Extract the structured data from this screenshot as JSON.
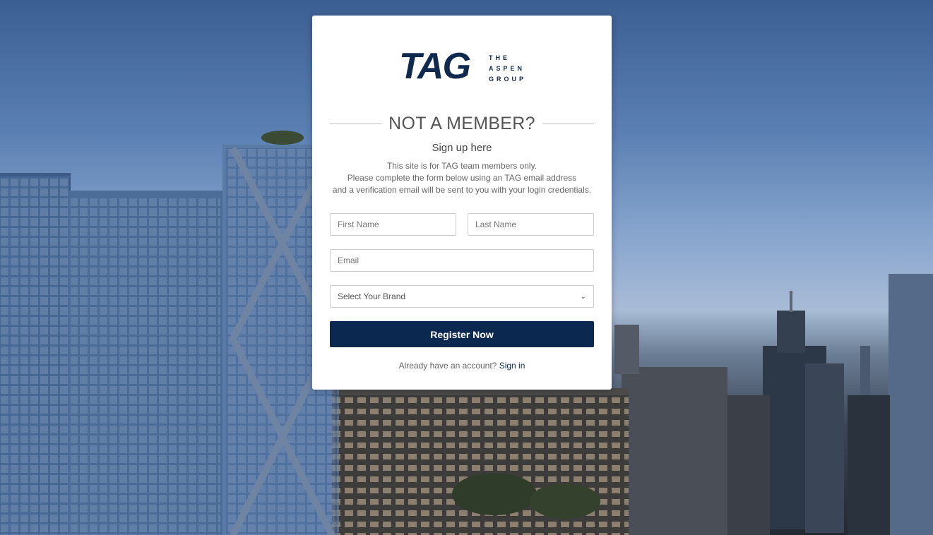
{
  "logo": {
    "wordmark": "TAG",
    "tagline": [
      "THE",
      "ASPEN",
      "GROUP"
    ]
  },
  "heading": "NOT A MEMBER?",
  "subheading": "Sign up here",
  "description": [
    "This site is for TAG team members only.",
    "Please complete the form below using an TAG email address",
    "and a verification email will be sent to you with your login credentials."
  ],
  "form": {
    "first_name_placeholder": "First Name",
    "last_name_placeholder": "Last Name",
    "email_placeholder": "Email",
    "brand_select": "Select Your Brand",
    "submit_label": "Register Now"
  },
  "footer": {
    "prompt": "Already have an account?",
    "link": "Sign in"
  },
  "colors": {
    "brand_navy": "#0b2850"
  }
}
